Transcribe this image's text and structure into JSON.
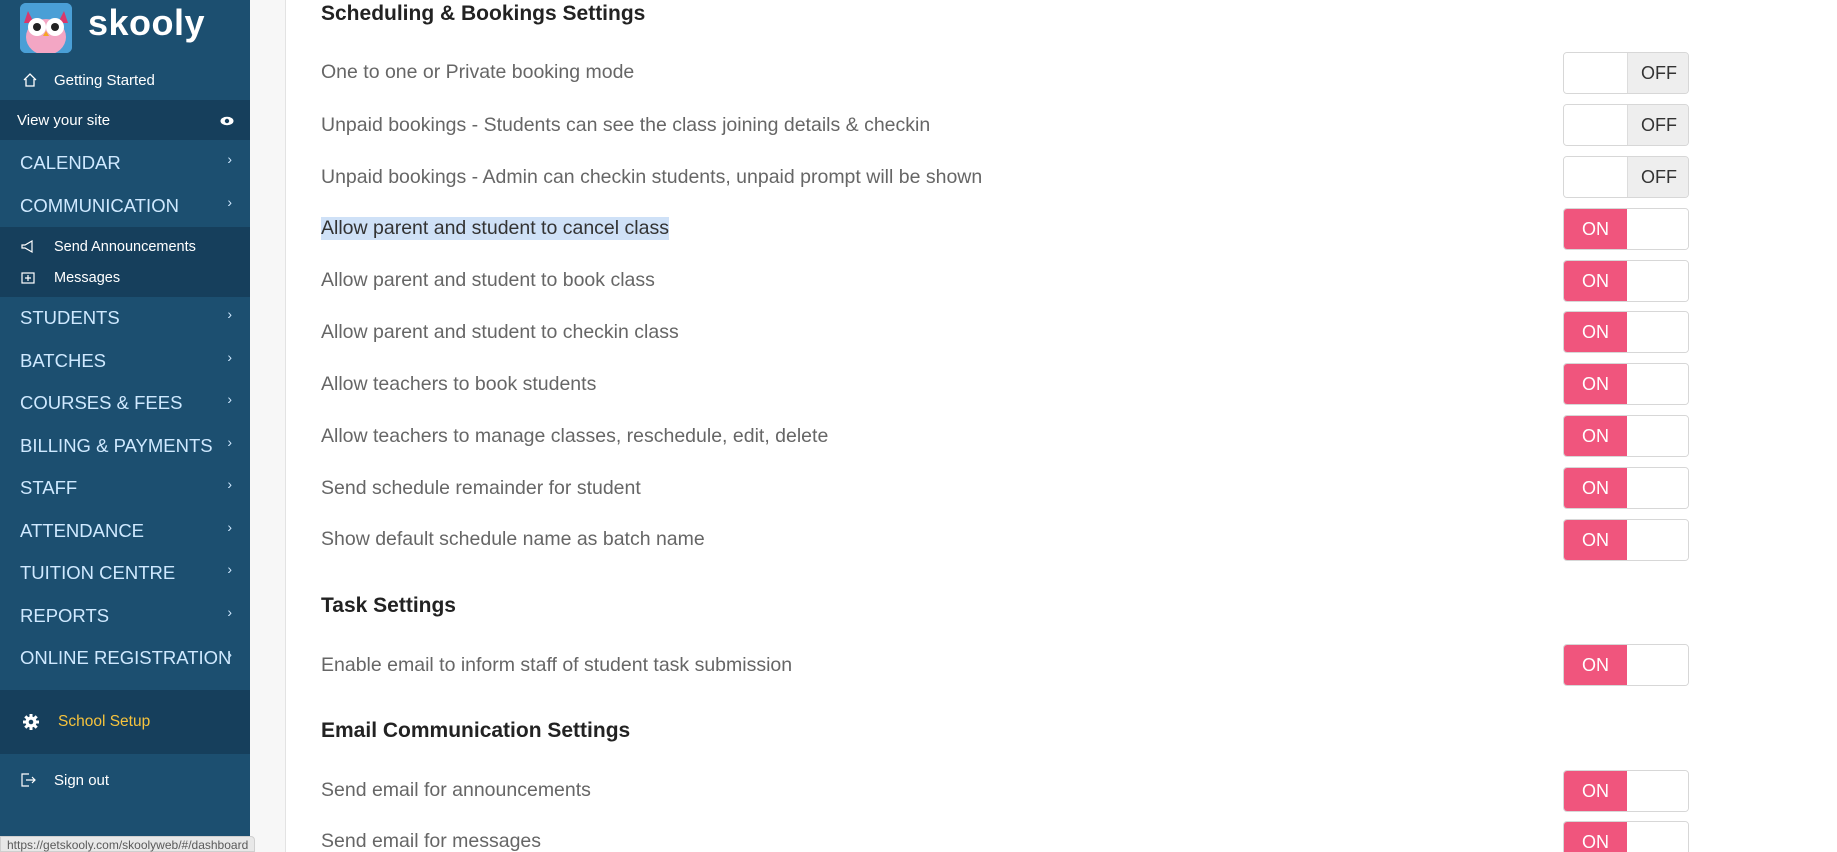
{
  "sidebar": {
    "brand": "skooly",
    "getting_started": "Getting Started",
    "view_site": "View your site",
    "nav": [
      {
        "label": "CALENDAR"
      },
      {
        "label": "COMMUNICATION"
      },
      {
        "label": "STUDENTS"
      },
      {
        "label": "BATCHES"
      },
      {
        "label": "COURSES & FEES"
      },
      {
        "label": "BILLING & PAYMENTS"
      },
      {
        "label": "STAFF"
      },
      {
        "label": "ATTENDANCE"
      },
      {
        "label": "TUITION CENTRE"
      },
      {
        "label": "REPORTS"
      },
      {
        "label": "ONLINE REGISTRATION"
      }
    ],
    "communication_sub": [
      {
        "label": "Send Announcements"
      },
      {
        "label": "Messages"
      }
    ],
    "school_setup": "School Setup",
    "sign_out": "Sign out",
    "status_url": "https://getskooly.com/skoolyweb/#/dashboard"
  },
  "colors": {
    "sidebar_bg": "#1c4f70",
    "toggle_on": "#f0557d",
    "setup_text": "#f6c33d"
  },
  "sections": {
    "scheduling_title": "Scheduling & Bookings Settings",
    "task_title": "Task Settings",
    "email_title": "Email Communication Settings"
  },
  "settings": [
    {
      "label": "One to one or Private booking mode",
      "state": "OFF"
    },
    {
      "label": "Unpaid bookings - Students can see the class joining details & checkin",
      "state": "OFF"
    },
    {
      "label": "Unpaid bookings - Admin can checkin students, unpaid prompt will be shown",
      "state": "OFF"
    },
    {
      "label": "Allow parent and student to cancel class",
      "state": "ON"
    },
    {
      "label": "Allow parent and student to book class",
      "state": "ON"
    },
    {
      "label": "Allow parent and student to checkin class",
      "state": "ON"
    },
    {
      "label": "Allow teachers to book students",
      "state": "ON"
    },
    {
      "label": "Allow teachers to manage classes, reschedule, edit, delete",
      "state": "ON"
    },
    {
      "label": "Send schedule remainder for student",
      "state": "ON"
    },
    {
      "label": "Show default schedule name as batch name",
      "state": "ON"
    },
    {
      "label": "Enable email to inform staff of student task submission",
      "state": "ON"
    },
    {
      "label": "Send email for announcements",
      "state": "ON"
    },
    {
      "label": "Send email for messages",
      "state": "ON"
    }
  ]
}
